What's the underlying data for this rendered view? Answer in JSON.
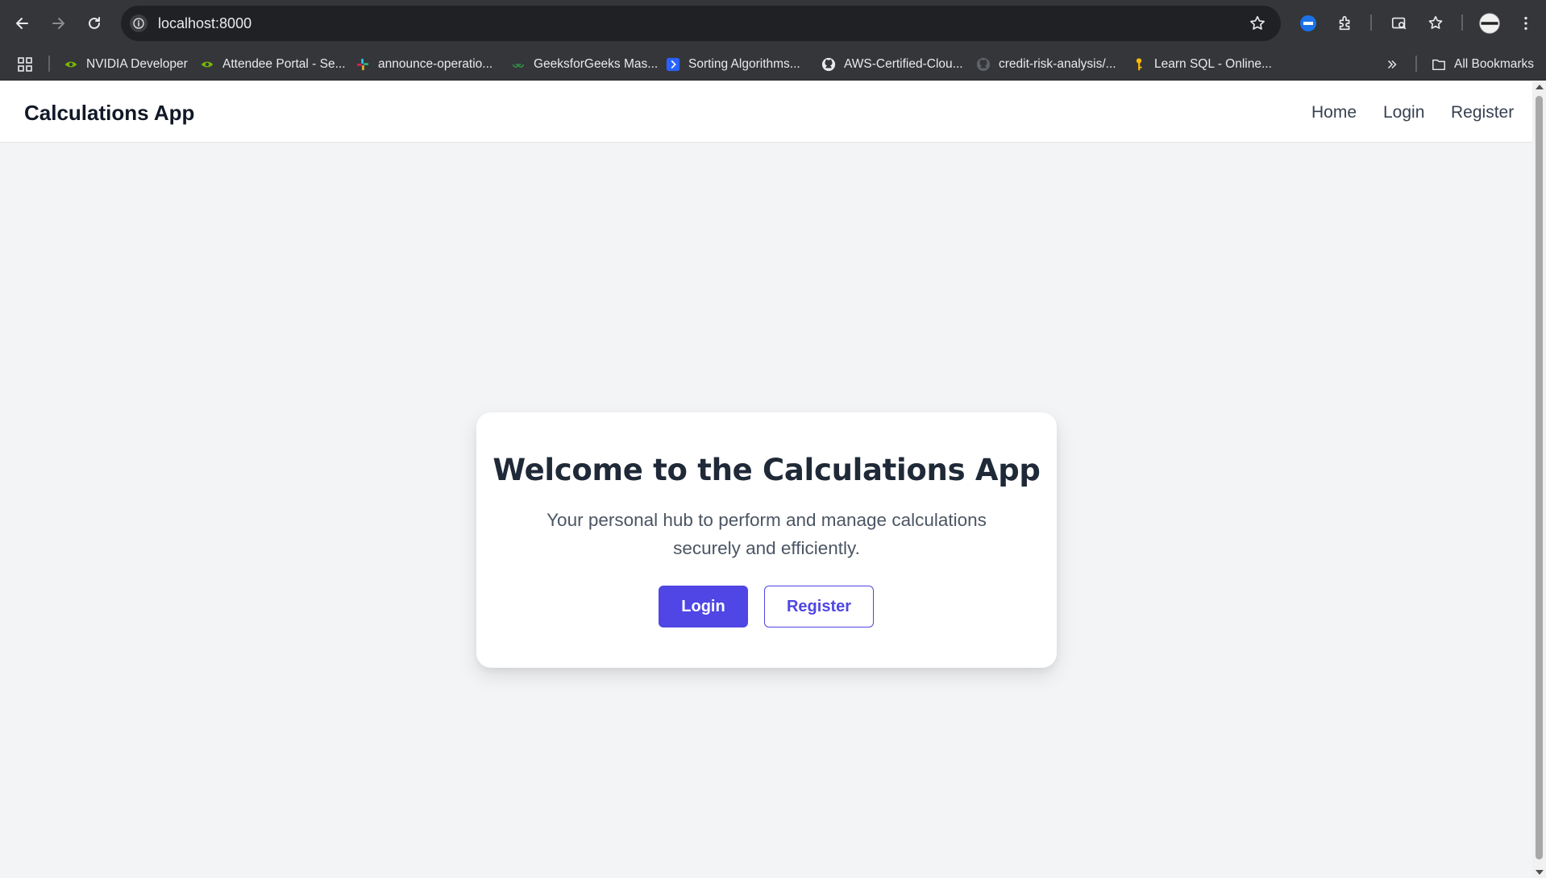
{
  "browser": {
    "url": "localhost:8000",
    "bookmarks": [
      {
        "label": "NVIDIA Developer",
        "icon": "nvidia-icon"
      },
      {
        "label": "Attendee Portal - Se...",
        "icon": "nvidia-icon"
      },
      {
        "label": "announce-operatio...",
        "icon": "slack-icon"
      },
      {
        "label": "GeeksforGeeks Mas...",
        "icon": "gfg-icon"
      },
      {
        "label": "Sorting Algorithms...",
        "icon": "bookmark-blue-icon"
      },
      {
        "label": "AWS-Certified-Clou...",
        "icon": "github-icon"
      },
      {
        "label": "credit-risk-analysis/...",
        "icon": "github-icon"
      },
      {
        "label": "Learn SQL - Online...",
        "icon": "key-icon"
      }
    ],
    "all_bookmarks_label": "All Bookmarks"
  },
  "app": {
    "brand": "Calculations App",
    "nav": {
      "home": "Home",
      "login": "Login",
      "register": "Register"
    },
    "hero": {
      "title": "Welcome to the Calculations App",
      "subtitle": "Your personal hub to perform and manage calculations securely and efficiently.",
      "login_button": "Login",
      "register_button": "Register"
    }
  },
  "colors": {
    "primary": "#4f46e5",
    "background": "#f3f4f6",
    "chrome": "#35363a"
  }
}
